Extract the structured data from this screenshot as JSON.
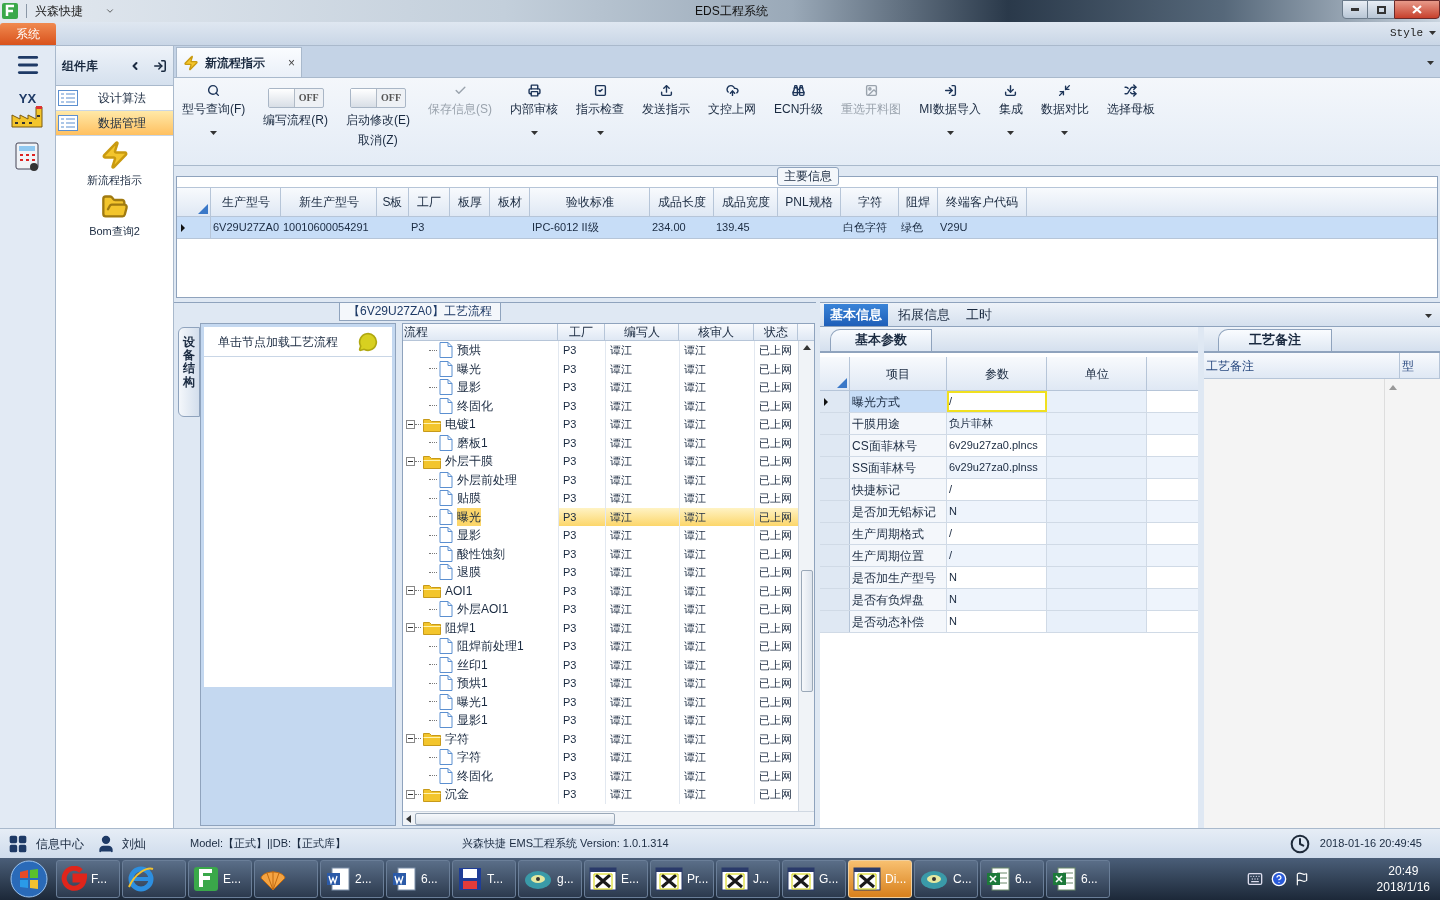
{
  "window": {
    "app_name": "兴森快捷",
    "title": "EDS工程系统"
  },
  "menu": {
    "tab": "系统",
    "style": "Style"
  },
  "rail": [
    {
      "kind": "menu"
    },
    {
      "kind": "factory",
      "text": "YX"
    },
    {
      "kind": "calculator"
    }
  ],
  "component_library": {
    "title": "组件库",
    "items": [
      {
        "label": "设计算法",
        "selected": false
      },
      {
        "label": "数据管理",
        "selected": true
      }
    ],
    "tools": [
      {
        "label": "新流程指示"
      },
      {
        "label": "Bom查询2"
      }
    ]
  },
  "doc_tab": {
    "label": "新流程指示",
    "close": "×"
  },
  "toolbar": [
    {
      "kind": "button",
      "label": "型号查询(F)",
      "dropdown": true,
      "disabled": false
    },
    {
      "kind": "toggle",
      "on": false,
      "text": "OFF",
      "lines": [
        "编写流程(R)"
      ]
    },
    {
      "kind": "toggle",
      "on": false,
      "text": "OFF",
      "lines": [
        "启动修改(E)",
        "取消(Z)"
      ]
    },
    {
      "kind": "button",
      "label": "保存信息(S)",
      "dropdown": false,
      "disabled": true
    },
    {
      "kind": "button",
      "label": "内部审核",
      "dropdown": true,
      "disabled": false
    },
    {
      "kind": "button",
      "label": "指示检查",
      "dropdown": true,
      "disabled": false
    },
    {
      "kind": "button",
      "label": "发送指示",
      "dropdown": false,
      "disabled": false
    },
    {
      "kind": "button",
      "label": "文控上网",
      "dropdown": false,
      "disabled": false
    },
    {
      "kind": "button",
      "label": "ECN升级",
      "dropdown": false,
      "disabled": false
    },
    {
      "kind": "button",
      "label": "重选开料图",
      "dropdown": false,
      "disabled": true
    },
    {
      "kind": "button",
      "label": "MI数据导入",
      "dropdown": true,
      "disabled": false
    },
    {
      "kind": "button",
      "label": "集成",
      "dropdown": true,
      "disabled": false
    },
    {
      "kind": "button",
      "label": "数据对比",
      "dropdown": true,
      "disabled": false
    },
    {
      "kind": "button",
      "label": "选择母板",
      "dropdown": false,
      "disabled": false
    }
  ],
  "main_info": {
    "title": "主要信息",
    "row_selected": true,
    "columns": [
      {
        "label": "生产型号",
        "value": "6V29U27ZA0"
      },
      {
        "label": "新生产型号",
        "value": "10010600054291"
      },
      {
        "label": "S板"
      },
      {
        "label": "工厂",
        "value": "P3"
      },
      {
        "label": "板厚"
      },
      {
        "label": "板材"
      },
      {
        "label": "验收标准",
        "value": "IPC-6012 II级"
      },
      {
        "label": "成品长度",
        "value": "234.00"
      },
      {
        "label": "成品宽度",
        "value": "139.45"
      },
      {
        "label": "PNL规格"
      },
      {
        "label": "字符",
        "value": "白色字符"
      },
      {
        "label": "阻焊",
        "value": "绿色"
      },
      {
        "label": "终端客户代码",
        "value": "V29U"
      }
    ]
  },
  "process": {
    "title": "【6V29U27ZA0】工艺流程",
    "side_tab": "设备结构",
    "hint": "单击节点加载工艺流程",
    "columns": [
      "流程",
      "工厂",
      "编写人",
      "核审人",
      "状态"
    ],
    "tree": [
      {
        "kind": "continued",
        "children": [
          {
            "kind": "file",
            "label": "预烘",
            "factory": "P3",
            "author": "谭江",
            "reviewer": "谭江",
            "status": "已上网",
            "selected": false
          },
          {
            "kind": "file",
            "label": "曝光",
            "factory": "P3",
            "author": "谭江",
            "reviewer": "谭江",
            "status": "已上网",
            "selected": false
          },
          {
            "kind": "file",
            "label": "显影",
            "factory": "P3",
            "author": "谭江",
            "reviewer": "谭江",
            "status": "已上网",
            "selected": false
          },
          {
            "kind": "file",
            "label": "终固化",
            "factory": "P3",
            "author": "谭江",
            "reviewer": "谭江",
            "status": "已上网",
            "selected": false
          }
        ]
      },
      {
        "kind": "folder",
        "label": "电镀1",
        "factory": "P3",
        "author": "谭江",
        "reviewer": "谭江",
        "status": "已上网",
        "selected": false,
        "expanded": true,
        "children": [
          {
            "kind": "file",
            "label": "磨板1",
            "factory": "P3",
            "author": "谭江",
            "reviewer": "谭江",
            "status": "已上网",
            "selected": false
          }
        ]
      },
      {
        "kind": "folder",
        "label": "外层干膜",
        "factory": "P3",
        "author": "谭江",
        "reviewer": "谭江",
        "status": "已上网",
        "selected": false,
        "expanded": true,
        "children": [
          {
            "kind": "file",
            "label": "外层前处理",
            "factory": "P3",
            "author": "谭江",
            "reviewer": "谭江",
            "status": "已上网",
            "selected": false
          },
          {
            "kind": "file",
            "label": "贴膜",
            "factory": "P3",
            "author": "谭江",
            "reviewer": "谭江",
            "status": "已上网",
            "selected": false
          },
          {
            "kind": "file",
            "label": "曝光",
            "factory": "P3",
            "author": "谭江",
            "reviewer": "谭江",
            "status": "已上网",
            "selected": true
          },
          {
            "kind": "file",
            "label": "显影",
            "factory": "P3",
            "author": "谭江",
            "reviewer": "谭江",
            "status": "已上网",
            "selected": false
          },
          {
            "kind": "file",
            "label": "酸性蚀刻",
            "factory": "P3",
            "author": "谭江",
            "reviewer": "谭江",
            "status": "已上网",
            "selected": false
          },
          {
            "kind": "file",
            "label": "退膜",
            "factory": "P3",
            "author": "谭江",
            "reviewer": "谭江",
            "status": "已上网",
            "selected": false
          }
        ]
      },
      {
        "kind": "folder",
        "label": "AOI1",
        "factory": "P3",
        "author": "谭江",
        "reviewer": "谭江",
        "status": "已上网",
        "selected": false,
        "expanded": true,
        "children": [
          {
            "kind": "file",
            "label": "外层AOI1",
            "factory": "P3",
            "author": "谭江",
            "reviewer": "谭江",
            "status": "已上网",
            "selected": false
          }
        ]
      },
      {
        "kind": "folder",
        "label": "阻焊1",
        "factory": "P3",
        "author": "谭江",
        "reviewer": "谭江",
        "status": "已上网",
        "selected": false,
        "expanded": true,
        "children": [
          {
            "kind": "file",
            "label": "阻焊前处理1",
            "factory": "P3",
            "author": "谭江",
            "reviewer": "谭江",
            "status": "已上网",
            "selected": false
          },
          {
            "kind": "file",
            "label": "丝印1",
            "factory": "P3",
            "author": "谭江",
            "reviewer": "谭江",
            "status": "已上网",
            "selected": false
          },
          {
            "kind": "file",
            "label": "预烘1",
            "factory": "P3",
            "author": "谭江",
            "reviewer": "谭江",
            "status": "已上网",
            "selected": false
          },
          {
            "kind": "file",
            "label": "曝光1",
            "factory": "P3",
            "author": "谭江",
            "reviewer": "谭江",
            "status": "已上网",
            "selected": false
          },
          {
            "kind": "file",
            "label": "显影1",
            "factory": "P3",
            "author": "谭江",
            "reviewer": "谭江",
            "status": "已上网",
            "selected": false
          }
        ]
      },
      {
        "kind": "folder",
        "label": "字符",
        "factory": "P3",
        "author": "谭江",
        "reviewer": "谭江",
        "status": "已上网",
        "selected": false,
        "expanded": true,
        "children": [
          {
            "kind": "file",
            "label": "字符",
            "factory": "P3",
            "author": "谭江",
            "reviewer": "谭江",
            "status": "已上网",
            "selected": false
          },
          {
            "kind": "file",
            "label": "终固化",
            "factory": "P3",
            "author": "谭江",
            "reviewer": "谭江",
            "status": "已上网",
            "selected": false
          }
        ]
      },
      {
        "kind": "folder",
        "label": "沉金",
        "factory": "P3",
        "author": "谭江",
        "reviewer": "谭江",
        "status": "已上网",
        "selected": false,
        "expanded": true
      }
    ]
  },
  "details": {
    "tabs": [
      {
        "label": "基本信息",
        "selected": true
      },
      {
        "label": "拓展信息",
        "selected": false
      },
      {
        "label": "工时",
        "selected": false
      }
    ],
    "params": {
      "tab": "基本参数",
      "columns": [
        "项目",
        "参数",
        "单位"
      ],
      "rows": [
        {
          "item": "曝光方式",
          "value": "/",
          "selected": true
        },
        {
          "item": "干膜用途",
          "value": "负片菲林",
          "selected": false
        },
        {
          "item": "CS面菲林号",
          "value": "6v29u27za0.plncs",
          "selected": false
        },
        {
          "item": "SS面菲林号",
          "value": "6v29u27za0.plnss",
          "selected": false
        },
        {
          "item": "快捷标记",
          "value": "/",
          "selected": false
        },
        {
          "item": "是否加无铅标记",
          "value": "N",
          "selected": false
        },
        {
          "item": "生产周期格式",
          "value": "/",
          "selected": false
        },
        {
          "item": "生产周期位置",
          "value": "/",
          "selected": false
        },
        {
          "item": "是否加生产型号",
          "value": "N",
          "selected": false
        },
        {
          "item": "是否有负焊盘",
          "value": "N",
          "selected": false
        },
        {
          "item": "是否动态补偿",
          "value": "N",
          "selected": false
        }
      ]
    },
    "notes": {
      "tab": "工艺备注",
      "columns": [
        "工艺备注",
        "型"
      ]
    }
  },
  "status_bar": {
    "info_center": "信息中心",
    "user": "刘灿",
    "model": "Model:【正式】||DB:【正式库】",
    "product": "兴森快捷 EMS工程系统 Version: 1.0.1.314",
    "datetime": "2018-01-16 20:49:45"
  },
  "taskbar": {
    "items": [
      {
        "label": "F...",
        "selected": false
      },
      {
        "selected": false
      },
      {
        "label": "E...",
        "selected": false
      },
      {
        "selected": false
      },
      {
        "label": "2...",
        "selected": false
      },
      {
        "label": "6...",
        "selected": false
      },
      {
        "label": "T...",
        "selected": false
      },
      {
        "label": "g...",
        "selected": false
      },
      {
        "label": "E...",
        "selected": false
      },
      {
        "label": "Pr...",
        "selected": false
      },
      {
        "label": "J...",
        "selected": false
      },
      {
        "label": "G...",
        "selected": false
      },
      {
        "label": "Di...",
        "selected": true
      },
      {
        "label": "C...",
        "selected": false
      },
      {
        "label": "6...",
        "selected": false
      },
      {
        "label": "6...",
        "selected": false
      }
    ],
    "time": "20:49",
    "date": "2018/1/16"
  }
}
